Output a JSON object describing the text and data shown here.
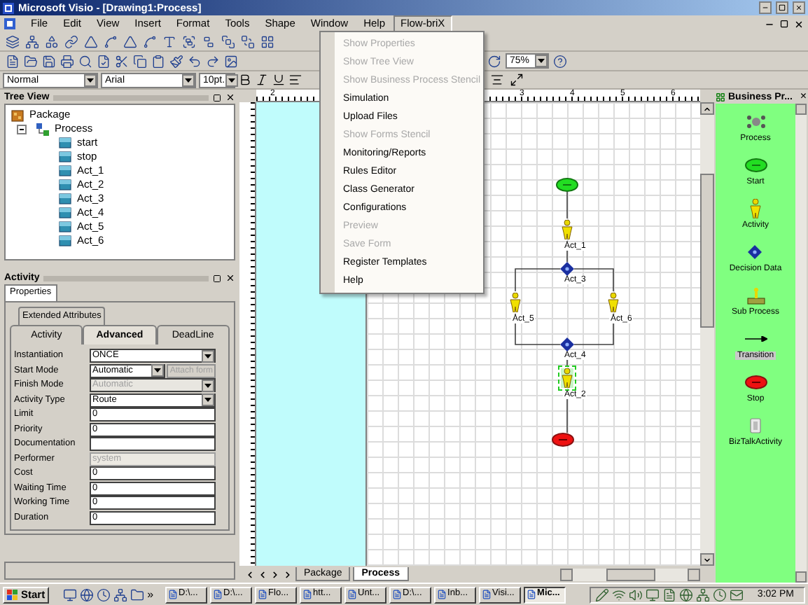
{
  "window": {
    "title": "Microsoft Visio - [Drawing1:Process]"
  },
  "menu_bar": [
    {
      "label": "File",
      "selected": false
    },
    {
      "label": "Edit",
      "selected": false
    },
    {
      "label": "View",
      "selected": false
    },
    {
      "label": "Insert",
      "selected": false
    },
    {
      "label": "Format",
      "selected": false
    },
    {
      "label": "Tools",
      "selected": false
    },
    {
      "label": "Shape",
      "selected": false
    },
    {
      "label": "Window",
      "selected": false
    },
    {
      "label": "Help",
      "selected": false
    },
    {
      "label": "Flow-briX",
      "selected": true
    }
  ],
  "toolbar": {
    "zoom": "75%",
    "style": "Normal",
    "font": "Arial",
    "size": "10pt."
  },
  "flow_brix_menu": [
    {
      "label": "Show Properties",
      "disabled": true
    },
    {
      "label": "Show Tree View",
      "disabled": true
    },
    {
      "label": "Show Business Process Stencil",
      "disabled": true
    },
    {
      "label": "Simulation",
      "disabled": false
    },
    {
      "label": "Upload Files",
      "disabled": false
    },
    {
      "label": "Show Forms Stencil",
      "disabled": true
    },
    {
      "label": "Monitoring/Reports",
      "disabled": false
    },
    {
      "label": "Rules Editor",
      "disabled": false
    },
    {
      "label": "Class Generator",
      "disabled": false
    },
    {
      "label": "Configurations",
      "disabled": false
    },
    {
      "label": "Preview",
      "disabled": true
    },
    {
      "label": "Save Form",
      "disabled": true
    },
    {
      "label": "Register Templates",
      "disabled": false
    },
    {
      "label": "Help",
      "disabled": false
    }
  ],
  "tree_view": {
    "title": "Tree View",
    "items": [
      {
        "label": "Package",
        "children": [
          {
            "label": "Process",
            "expanded": true,
            "children": [
              {
                "label": "start"
              },
              {
                "label": "stop"
              },
              {
                "label": "Act_1"
              },
              {
                "label": "Act_2"
              },
              {
                "label": "Act_3"
              },
              {
                "label": "Act_4"
              },
              {
                "label": "Act_5"
              },
              {
                "label": "Act_6"
              }
            ]
          }
        ]
      }
    ]
  },
  "activity_panel": {
    "title": "Activity",
    "tabs": [
      {
        "label": "Properties",
        "selected": true
      }
    ],
    "back_tabs": [
      {
        "label": "Extended Attributes",
        "selected": false
      }
    ],
    "sub_tabs": [
      {
        "label": "Activity",
        "selected": false
      },
      {
        "label": "Advanced",
        "selected": true
      },
      {
        "label": "DeadLine",
        "selected": false
      }
    ],
    "fields": [
      {
        "label": "Instantiation",
        "kind": "dropdown",
        "value": "ONCE",
        "disabled": false
      },
      {
        "label": "Start Mode",
        "kind": "dropdown",
        "value": "Automatic",
        "disabled": false,
        "button": {
          "label": "Attach form",
          "disabled": true
        }
      },
      {
        "label": "Finish Mode",
        "kind": "dropdown",
        "value": "Automatic",
        "disabled": true
      },
      {
        "label": "Activity Type",
        "kind": "dropdown",
        "value": "Route",
        "disabled": false
      },
      {
        "label": "Limit",
        "kind": "text",
        "value": "0",
        "disabled": false
      },
      {
        "label": "Priority",
        "kind": "text",
        "value": "0",
        "disabled": false
      },
      {
        "label": "Documentation",
        "kind": "text",
        "disabled": false
      },
      {
        "label": "Performer",
        "kind": "text",
        "value": "system",
        "disabled": true
      },
      {
        "label": "Cost",
        "kind": "text",
        "value": "0",
        "disabled": false
      },
      {
        "label": "Waiting Time",
        "kind": "text",
        "value": "0",
        "disabled": false
      },
      {
        "label": "Working Time",
        "kind": "text",
        "value": "0",
        "disabled": false
      },
      {
        "label": "Duration",
        "kind": "text",
        "value": "0",
        "disabled": false
      }
    ]
  },
  "ruler": {
    "top_labels": [
      "2",
      "3",
      "4",
      "5",
      "6"
    ]
  },
  "diagram": {
    "nodes": [
      {
        "kind": "start",
        "selected": false
      },
      {
        "kind": "activity",
        "label": "Act_1",
        "selected": false
      },
      {
        "kind": "decision",
        "label": "Act_3",
        "selected": false
      },
      {
        "kind": "activity",
        "label": "Act_5",
        "selected": false
      },
      {
        "kind": "activity",
        "label": "Act_6",
        "selected": false
      },
      {
        "kind": "decision",
        "label": "Act_4",
        "selected": false
      },
      {
        "kind": "activity",
        "label": "Act_2",
        "selected": true
      },
      {
        "kind": "stop",
        "selected": false
      }
    ]
  },
  "page_tabs": [
    {
      "label": "Package",
      "selected": false
    },
    {
      "label": "Process",
      "selected": true
    }
  ],
  "stencil": {
    "title": "Business Pr...",
    "close": "×",
    "items": [
      {
        "label": "Process",
        "kind": "process",
        "selected": false
      },
      {
        "label": "Start",
        "kind": "start",
        "selected": false
      },
      {
        "label": "Activity",
        "kind": "activity",
        "selected": false
      },
      {
        "label": "Decision Data",
        "kind": "decision",
        "selected": false
      },
      {
        "label": "Sub Process",
        "kind": "subprocess",
        "selected": false
      },
      {
        "label": "Transition",
        "kind": "transition",
        "selected": true
      },
      {
        "label": "Stop",
        "kind": "stop",
        "selected": false
      },
      {
        "label": "BizTalkActivity",
        "kind": "biztalk",
        "selected": false
      }
    ]
  },
  "taskbar": {
    "start": "Start",
    "more": "»",
    "tasks": [
      {
        "label": "D:\\...",
        "selected": false
      },
      {
        "label": "D:\\...",
        "selected": false
      },
      {
        "label": "Flo...",
        "selected": false
      },
      {
        "label": "htt...",
        "selected": false
      },
      {
        "label": "Unt...",
        "selected": false
      },
      {
        "label": "D:\\...",
        "selected": false
      },
      {
        "label": "Inb...",
        "selected": false
      },
      {
        "label": "Visi...",
        "selected": false
      },
      {
        "label": "Mic...",
        "selected": true
      }
    ],
    "clock": "3:02 PM"
  }
}
